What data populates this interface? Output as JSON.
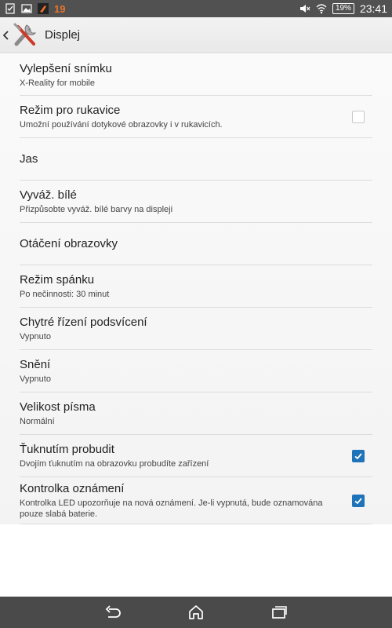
{
  "status_bar": {
    "notification_count": "19",
    "battery": "19%",
    "time": "23:41",
    "icons": [
      "checklist-icon",
      "image-icon",
      "app-notification-icon",
      "mute-icon",
      "wifi-icon",
      "battery-icon"
    ]
  },
  "action_bar": {
    "title": "Displej",
    "icon": "tools-icon"
  },
  "settings": [
    {
      "title": "Vylepšení snímku",
      "subtitle": "X-Reality for mobile"
    },
    {
      "title": "Režim pro rukavice",
      "subtitle": "Umožní používání dotykové obrazovky i v rukavicích.",
      "checkbox": false
    },
    {
      "title": "Jas"
    },
    {
      "title": "Vyváž. bílé",
      "subtitle": "Přizpůsobte vyváž. bílé barvy na displeji"
    },
    {
      "title": "Otáčení obrazovky"
    },
    {
      "title": "Režim spánku",
      "subtitle": "Po nečinnosti: 30 minut"
    },
    {
      "title": "Chytré řízení podsvícení",
      "subtitle": "Vypnuto"
    },
    {
      "title": "Snění",
      "subtitle": "Vypnuto"
    },
    {
      "title": "Velikost písma",
      "subtitle": "Normální"
    },
    {
      "title": "Ťuknutím probudit",
      "subtitle": "Dvojím ťuknutím na obrazovku probudíte zařízení",
      "checkbox": true
    },
    {
      "title": "Kontrolka oznámení",
      "subtitle": "Kontrolka LED upozorňuje na nová oznámení. Je-li vypnutá, bude oznamována pouze slabá baterie.",
      "checkbox": true
    }
  ],
  "nav_bar": {
    "buttons": [
      "back-icon",
      "home-icon",
      "recents-icon"
    ]
  },
  "colors": {
    "status_bar": "#515151",
    "accent": "#1e73b9",
    "notification_count": "#e8742e",
    "nav_bar": "#4a4a4a"
  }
}
